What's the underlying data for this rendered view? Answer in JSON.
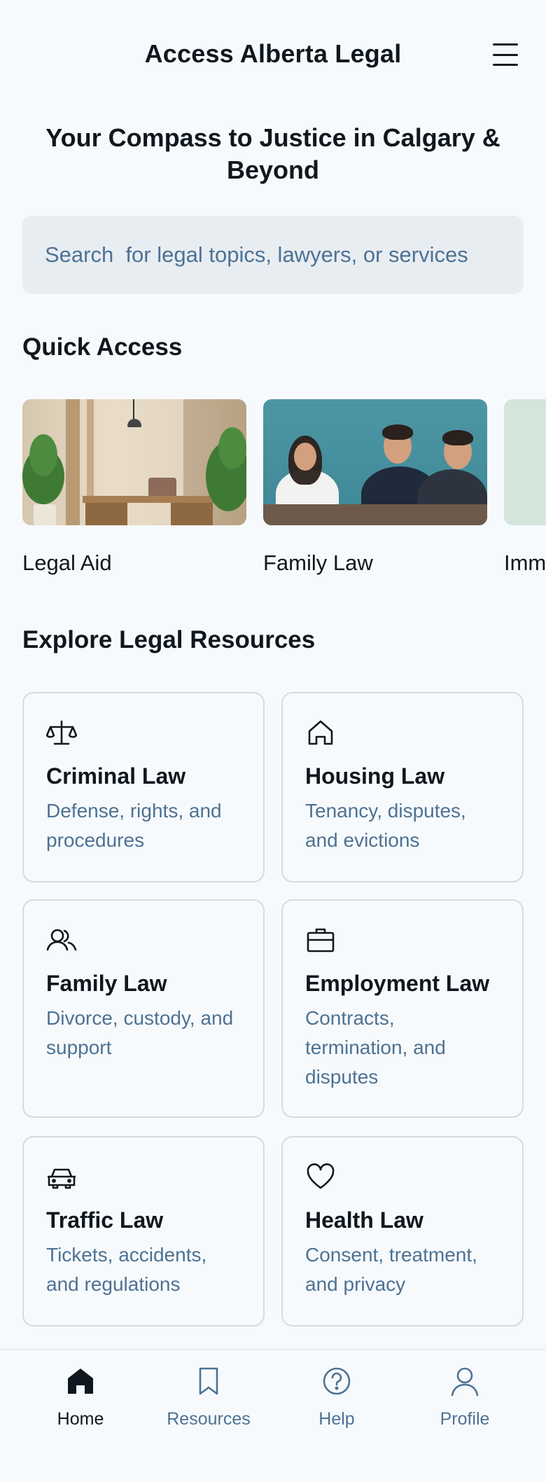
{
  "header": {
    "title": "Access Alberta Legal"
  },
  "hero": {
    "headline": "Your Compass to Justice in Calgary & Beyond"
  },
  "search": {
    "placeholder": "Search  for legal topics, lawyers, or services"
  },
  "quick_access": {
    "title": "Quick Access",
    "items": [
      {
        "label": "Legal Aid",
        "image": "office-image"
      },
      {
        "label": "Family Law",
        "image": "meeting-image"
      },
      {
        "label": "Imm",
        "image": "partial-image"
      }
    ]
  },
  "explore": {
    "title": "Explore Legal Resources",
    "cards": [
      {
        "icon": "scales-icon",
        "title": "Criminal Law",
        "desc": "Defense, rights, and procedures"
      },
      {
        "icon": "house-icon",
        "title": "Housing Law",
        "desc": "Tenancy, disputes, and evictions"
      },
      {
        "icon": "users-icon",
        "title": "Family Law",
        "desc": "Divorce, custody, and support"
      },
      {
        "icon": "briefcase-icon",
        "title": "Employment Law",
        "desc": "Contracts, termination, and disputes"
      },
      {
        "icon": "car-icon",
        "title": "Traffic Law",
        "desc": "Tickets, accidents, and regulations"
      },
      {
        "icon": "heart-icon",
        "title": "Health Law",
        "desc": "Consent, treatment, and privacy"
      }
    ]
  },
  "bottom_nav": {
    "items": [
      {
        "label": "Home",
        "icon": "home-icon",
        "active": true
      },
      {
        "label": "Resources",
        "icon": "bookmark-icon",
        "active": false
      },
      {
        "label": "Help",
        "icon": "help-icon",
        "active": false
      },
      {
        "label": "Profile",
        "icon": "user-icon",
        "active": false
      }
    ]
  },
  "colors": {
    "background": "#f7fafc",
    "text": "#0f171f",
    "muted": "#4d7294",
    "search_bg": "#e8edf2",
    "card_border": "#d3dbe3"
  }
}
